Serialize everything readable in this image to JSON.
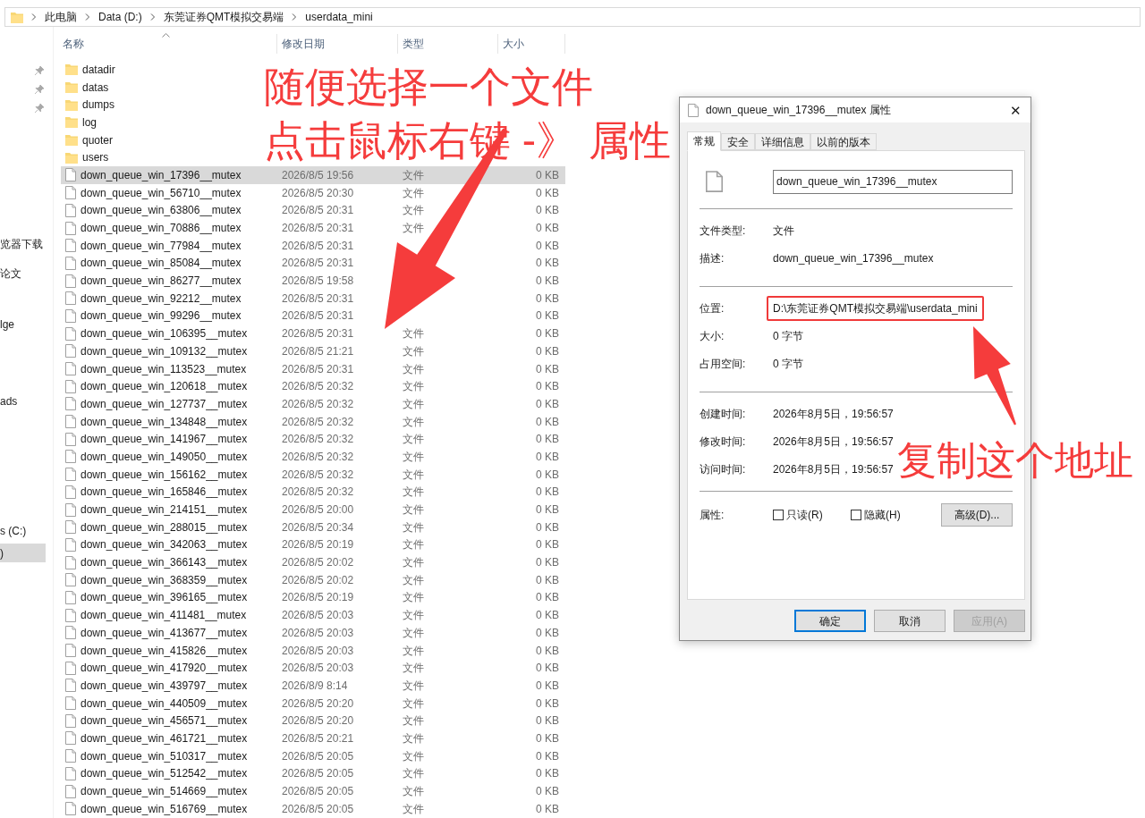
{
  "address_bar": {
    "crumbs": [
      "此电脑",
      "Data (D:)",
      "东莞证券QMT模拟交易端",
      "userdata_mini"
    ]
  },
  "sidebar": {
    "items": [
      {
        "label": "览器下载",
        "selected": false
      },
      {
        "label": "论文",
        "selected": false
      },
      {
        "label": "lge",
        "selected": false
      },
      {
        "label": "ads",
        "selected": false
      },
      {
        "label": "s (C:)",
        "selected": false
      },
      {
        "label": ")",
        "selected": true
      }
    ]
  },
  "file_list": {
    "columns": [
      "名称",
      "修改日期",
      "类型",
      "大小"
    ],
    "rows": [
      {
        "kind": "folder",
        "name": "datadir",
        "selected": false
      },
      {
        "kind": "folder",
        "name": "datas",
        "selected": false
      },
      {
        "kind": "folder",
        "name": "dumps",
        "selected": false
      },
      {
        "kind": "folder",
        "name": "log",
        "selected": false
      },
      {
        "kind": "folder",
        "name": "quoter",
        "selected": false
      },
      {
        "kind": "folder",
        "name": "users",
        "selected": false
      },
      {
        "kind": "file",
        "name": "down_queue_win_17396__mutex",
        "date": "2026/8/5 19:56",
        "type": "文件",
        "size": "0 KB",
        "selected": true
      },
      {
        "kind": "file",
        "name": "down_queue_win_56710__mutex",
        "date": "2026/8/5 20:30",
        "type": "文件",
        "size": "0 KB",
        "selected": false
      },
      {
        "kind": "file",
        "name": "down_queue_win_63806__mutex",
        "date": "2026/8/5 20:31",
        "type": "文件",
        "size": "0 KB",
        "selected": false
      },
      {
        "kind": "file",
        "name": "down_queue_win_70886__mutex",
        "date": "2026/8/5 20:31",
        "type": "文件",
        "size": "0 KB",
        "selected": false
      },
      {
        "kind": "file",
        "name": "down_queue_win_77984__mutex",
        "date": "2026/8/5 20:31",
        "size": "0 KB",
        "selected": false
      },
      {
        "kind": "file",
        "name": "down_queue_win_85084__mutex",
        "date": "2026/8/5 20:31",
        "size": "0 KB",
        "selected": false
      },
      {
        "kind": "file",
        "name": "down_queue_win_86277__mutex",
        "date": "2026/8/5 19:58",
        "size": "0 KB",
        "selected": false
      },
      {
        "kind": "file",
        "name": "down_queue_win_92212__mutex",
        "date": "2026/8/5 20:31",
        "size": "0 KB",
        "selected": false
      },
      {
        "kind": "file",
        "name": "down_queue_win_99296__mutex",
        "date": "2026/8/5 20:31",
        "size": "0 KB",
        "selected": false
      },
      {
        "kind": "file",
        "name": "down_queue_win_106395__mutex",
        "date": "2026/8/5 20:31",
        "type": "文件",
        "size": "0 KB",
        "selected": false
      },
      {
        "kind": "file",
        "name": "down_queue_win_109132__mutex",
        "date": "2026/8/5 21:21",
        "type": "文件",
        "size": "0 KB",
        "selected": false
      },
      {
        "kind": "file",
        "name": "down_queue_win_113523__mutex",
        "date": "2026/8/5 20:31",
        "type": "文件",
        "size": "0 KB",
        "selected": false
      },
      {
        "kind": "file",
        "name": "down_queue_win_120618__mutex",
        "date": "2026/8/5 20:32",
        "type": "文件",
        "size": "0 KB",
        "selected": false
      },
      {
        "kind": "file",
        "name": "down_queue_win_127737__mutex",
        "date": "2026/8/5 20:32",
        "type": "文件",
        "size": "0 KB",
        "selected": false
      },
      {
        "kind": "file",
        "name": "down_queue_win_134848__mutex",
        "date": "2026/8/5 20:32",
        "type": "文件",
        "size": "0 KB",
        "selected": false
      },
      {
        "kind": "file",
        "name": "down_queue_win_141967__mutex",
        "date": "2026/8/5 20:32",
        "type": "文件",
        "size": "0 KB",
        "selected": false
      },
      {
        "kind": "file",
        "name": "down_queue_win_149050__mutex",
        "date": "2026/8/5 20:32",
        "type": "文件",
        "size": "0 KB",
        "selected": false
      },
      {
        "kind": "file",
        "name": "down_queue_win_156162__mutex",
        "date": "2026/8/5 20:32",
        "type": "文件",
        "size": "0 KB",
        "selected": false
      },
      {
        "kind": "file",
        "name": "down_queue_win_165846__mutex",
        "date": "2026/8/5 20:32",
        "type": "文件",
        "size": "0 KB",
        "selected": false
      },
      {
        "kind": "file",
        "name": "down_queue_win_214151__mutex",
        "date": "2026/8/5 20:00",
        "type": "文件",
        "size": "0 KB",
        "selected": false
      },
      {
        "kind": "file",
        "name": "down_queue_win_288015__mutex",
        "date": "2026/8/5 20:34",
        "type": "文件",
        "size": "0 KB",
        "selected": false
      },
      {
        "kind": "file",
        "name": "down_queue_win_342063__mutex",
        "date": "2026/8/5 20:19",
        "type": "文件",
        "size": "0 KB",
        "selected": false
      },
      {
        "kind": "file",
        "name": "down_queue_win_366143__mutex",
        "date": "2026/8/5 20:02",
        "type": "文件",
        "size": "0 KB",
        "selected": false
      },
      {
        "kind": "file",
        "name": "down_queue_win_368359__mutex",
        "date": "2026/8/5 20:02",
        "type": "文件",
        "size": "0 KB",
        "selected": false
      },
      {
        "kind": "file",
        "name": "down_queue_win_396165__mutex",
        "date": "2026/8/5 20:19",
        "type": "文件",
        "size": "0 KB",
        "selected": false
      },
      {
        "kind": "file",
        "name": "down_queue_win_411481__mutex",
        "date": "2026/8/5 20:03",
        "type": "文件",
        "size": "0 KB",
        "selected": false
      },
      {
        "kind": "file",
        "name": "down_queue_win_413677__mutex",
        "date": "2026/8/5 20:03",
        "type": "文件",
        "size": "0 KB",
        "selected": false
      },
      {
        "kind": "file",
        "name": "down_queue_win_415826__mutex",
        "date": "2026/8/5 20:03",
        "type": "文件",
        "size": "0 KB",
        "selected": false
      },
      {
        "kind": "file",
        "name": "down_queue_win_417920__mutex",
        "date": "2026/8/5 20:03",
        "type": "文件",
        "size": "0 KB",
        "selected": false
      },
      {
        "kind": "file",
        "name": "down_queue_win_439797__mutex",
        "date": "2026/8/9 8:14",
        "type": "文件",
        "size": "0 KB",
        "selected": false
      },
      {
        "kind": "file",
        "name": "down_queue_win_440509__mutex",
        "date": "2026/8/5 20:20",
        "type": "文件",
        "size": "0 KB",
        "selected": false
      },
      {
        "kind": "file",
        "name": "down_queue_win_456571__mutex",
        "date": "2026/8/5 20:20",
        "type": "文件",
        "size": "0 KB",
        "selected": false
      },
      {
        "kind": "file",
        "name": "down_queue_win_461721__mutex",
        "date": "2026/8/5 20:21",
        "type": "文件",
        "size": "0 KB",
        "selected": false
      },
      {
        "kind": "file",
        "name": "down_queue_win_510317__mutex",
        "date": "2026/8/5 20:05",
        "type": "文件",
        "size": "0 KB",
        "selected": false
      },
      {
        "kind": "file",
        "name": "down_queue_win_512542__mutex",
        "date": "2026/8/5 20:05",
        "type": "文件",
        "size": "0 KB",
        "selected": false
      },
      {
        "kind": "file",
        "name": "down_queue_win_514669__mutex",
        "date": "2026/8/5 20:05",
        "type": "文件",
        "size": "0 KB",
        "selected": false
      },
      {
        "kind": "file",
        "name": "down_queue_win_516769__mutex",
        "date": "2026/8/5 20:05",
        "type": "文件",
        "size": "0 KB",
        "selected": false
      }
    ]
  },
  "dialog": {
    "title": "down_queue_win_17396__mutex 属性",
    "close": "✕",
    "tabs": [
      {
        "label": "常规",
        "selected": true
      },
      {
        "label": "安全",
        "selected": false
      },
      {
        "label": "详细信息",
        "selected": false
      },
      {
        "label": "以前的版本",
        "selected": false
      }
    ],
    "name_field": "down_queue_win_17396__mutex",
    "sections": [
      [
        {
          "label": "文件类型:",
          "value": "文件",
          "highlighted": false
        },
        {
          "label": "描述:",
          "value": "down_queue_win_17396__mutex",
          "highlighted": false
        }
      ],
      [
        {
          "label": "位置:",
          "value": "D:\\东莞证券QMT模拟交易端\\userdata_mini",
          "highlighted": true
        },
        {
          "label": "大小:",
          "value": "0 字节",
          "highlighted": false
        },
        {
          "label": "占用空间:",
          "value": "0 字节",
          "highlighted": false
        }
      ],
      [
        {
          "label": "创建时间:",
          "value": "2026年8月5日，19:56:57",
          "highlighted": false
        },
        {
          "label": "修改时间:",
          "value": "2026年8月5日，19:56:57",
          "highlighted": false
        },
        {
          "label": "访问时间:",
          "value": "2026年8月5日，19:56:57",
          "highlighted": false
        }
      ]
    ],
    "attributes": {
      "label": "属性:",
      "checkboxes": [
        {
          "label": "只读(R)",
          "checked": false
        },
        {
          "label": "隐藏(H)",
          "checked": false
        }
      ],
      "advanced": "高级(D)..."
    },
    "buttons": [
      {
        "label": "确定",
        "default": true,
        "disabled": false
      },
      {
        "label": "取消",
        "default": false,
        "disabled": false
      },
      {
        "label": "应用(A)",
        "default": false,
        "disabled": true
      }
    ]
  },
  "annotations": {
    "instruction_lines": [
      "随便选择一个文件",
      "点击鼠标右键 -》 属性"
    ],
    "copy_note": "复制这个地址"
  }
}
